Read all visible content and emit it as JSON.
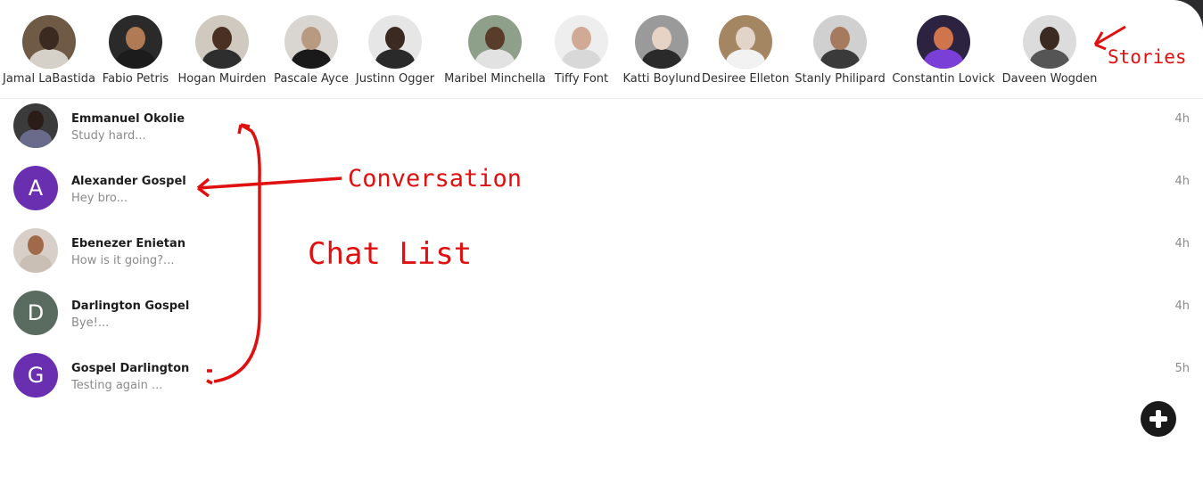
{
  "stories": [
    {
      "name": "Jamal LaBastida",
      "colors": [
        "#6f5a45",
        "#3a2a20",
        "#d5d0c8"
      ]
    },
    {
      "name": "Fabio Petris",
      "colors": [
        "#2a2a2a",
        "#b07a55",
        "#1c1c1c"
      ]
    },
    {
      "name": "Hogan Muirden",
      "colors": [
        "#cfc9c0",
        "#4a3023",
        "#2e2e2e"
      ]
    },
    {
      "name": "Pascale Ayce",
      "colors": [
        "#d9d5d0",
        "#b89a80",
        "#1a1a1a"
      ]
    },
    {
      "name": "Justinn Ogger",
      "colors": [
        "#e6e6e6",
        "#3b2a22",
        "#2a2a2a"
      ]
    },
    {
      "name": "Maribel Minchella",
      "colors": [
        "#8fa08a",
        "#5a3c2a",
        "#e2e2e2"
      ]
    },
    {
      "name": "Tiffy Font",
      "colors": [
        "#eeeeee",
        "#d0aa95",
        "#d8d8d8"
      ]
    },
    {
      "name": "Katti Boylund",
      "colors": [
        "#9a9a9a",
        "#e6d3c6",
        "#2a2a2a"
      ]
    },
    {
      "name": "Desiree Elleton",
      "colors": [
        "#a48663",
        "#e2d4c8",
        "#f2f2f2"
      ]
    },
    {
      "name": "Stanly Philipard",
      "colors": [
        "#d0d0d0",
        "#a57a5e",
        "#3a3a3a"
      ]
    },
    {
      "name": "Constantin Lovick",
      "colors": [
        "#2b2340",
        "#d0744c",
        "#7a3fd6"
      ]
    },
    {
      "name": "Daveen Wogden",
      "colors": [
        "#dcdcdc",
        "#3a2a22",
        "#555555"
      ]
    }
  ],
  "chats": [
    {
      "name": "Emmanuel Okolie",
      "message": "Study hard...",
      "time": "4h",
      "avatar_type": "photo",
      "colors": [
        "#3b3b3b",
        "#2a1c16",
        "#6a6a8a"
      ]
    },
    {
      "name": "Alexander Gospel",
      "message": "Hey bro...",
      "time": "4h",
      "avatar_type": "letter",
      "letter": "A",
      "color": "#6a2fb0"
    },
    {
      "name": "Ebenezer Enietan",
      "message": "How is it going?...",
      "time": "4h",
      "avatar_type": "photo",
      "colors": [
        "#d8d0c8",
        "#a06a4a",
        "#c9bfb5"
      ]
    },
    {
      "name": "Darlington Gospel",
      "message": "Bye!...",
      "time": "4h",
      "avatar_type": "letter",
      "letter": "D",
      "color": "#5a6b60"
    },
    {
      "name": "Gospel Darlington",
      "message": "Testing again ...",
      "time": "5h",
      "avatar_type": "letter",
      "letter": "G",
      "color": "#6a2fb0"
    }
  ],
  "fab": {
    "icon": "plus-icon"
  },
  "annotations": {
    "stories": "Stories",
    "conversation": "Conversation",
    "chat_list": "Chat List"
  },
  "accent_color": "#e01010"
}
